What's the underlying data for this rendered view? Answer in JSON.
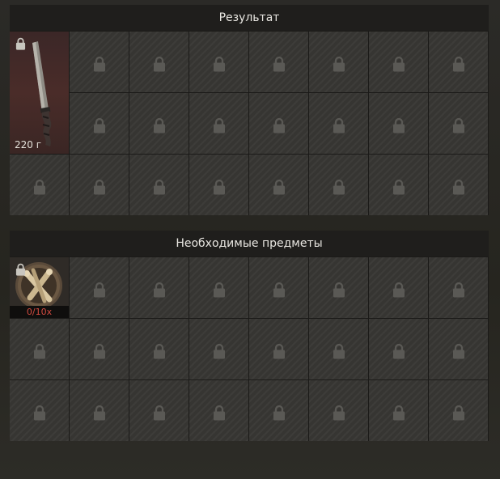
{
  "result_section": {
    "title": "Результат",
    "item": {
      "icon": "knife-icon",
      "weight": "220 г",
      "locked": true
    }
  },
  "required_section": {
    "title": "Необходимые предметы",
    "item": {
      "icon": "bone-bundle-icon",
      "count": "0/10x",
      "locked": true
    }
  },
  "colors": {
    "count_text": "#d24b40",
    "header_bg": "#1f1e1c",
    "slot_bg": "#363532",
    "lock_icon": "#5a5955"
  }
}
